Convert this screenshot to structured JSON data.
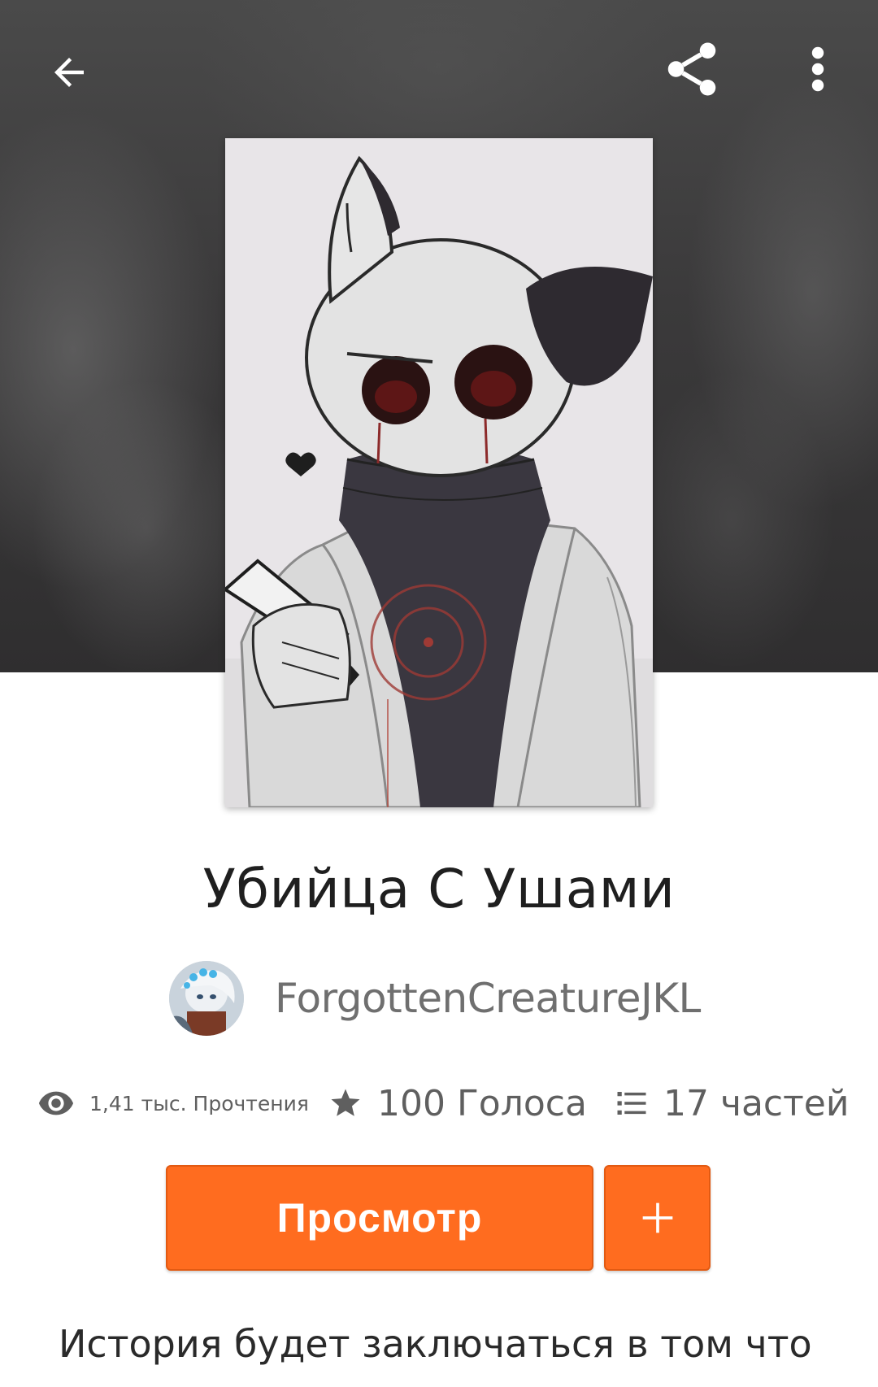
{
  "topbar": {
    "back_icon": "arrow-left-icon",
    "share_icon": "share-icon",
    "more_icon": "more-vertical-icon"
  },
  "story": {
    "title": "Убийца С Ушами",
    "author": "ForgottenCreatureJKL",
    "description": "История будет заключаться в том что"
  },
  "stats": {
    "reads_label": "1,41 тыс. Прочтения",
    "votes_label": "100 Голоса",
    "parts_label": "17 частей",
    "reads_icon": "eye-icon",
    "votes_icon": "star-icon",
    "parts_icon": "list-icon"
  },
  "actions": {
    "read_label": "Просмотр",
    "add_label": "+"
  },
  "colors": {
    "accent": "#ff6c1f",
    "accent_border": "#e25a12",
    "text_primary": "#1f1f1f",
    "text_secondary": "#6f6f6f"
  }
}
